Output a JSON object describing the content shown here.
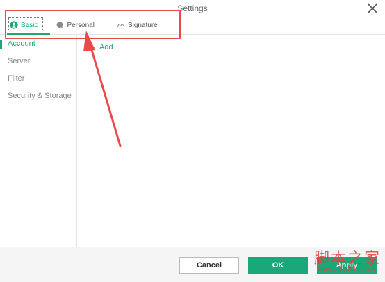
{
  "window": {
    "title": "Settings"
  },
  "tabs": [
    {
      "label": "Basic",
      "icon": "user-icon",
      "active": true
    },
    {
      "label": "Personal",
      "icon": "chat-bubble-icon",
      "active": false
    },
    {
      "label": "Signature",
      "icon": "signature-icon",
      "active": false
    }
  ],
  "sidebar": {
    "items": [
      {
        "label": "Account",
        "active": true
      },
      {
        "label": "Server",
        "active": false
      },
      {
        "label": "Filter",
        "active": false
      },
      {
        "label": "Security & Storage",
        "active": false
      }
    ]
  },
  "content": {
    "add_label": "Add"
  },
  "footer": {
    "cancel_label": "Cancel",
    "ok_label": "OK",
    "apply_label": "Apply"
  },
  "watermark": {
    "chars": "脚本之家",
    "url": "www.jb51.net"
  },
  "colors": {
    "accent": "#1aa77a",
    "annotation": "#e94b4b",
    "border": "#e4e4e4"
  }
}
